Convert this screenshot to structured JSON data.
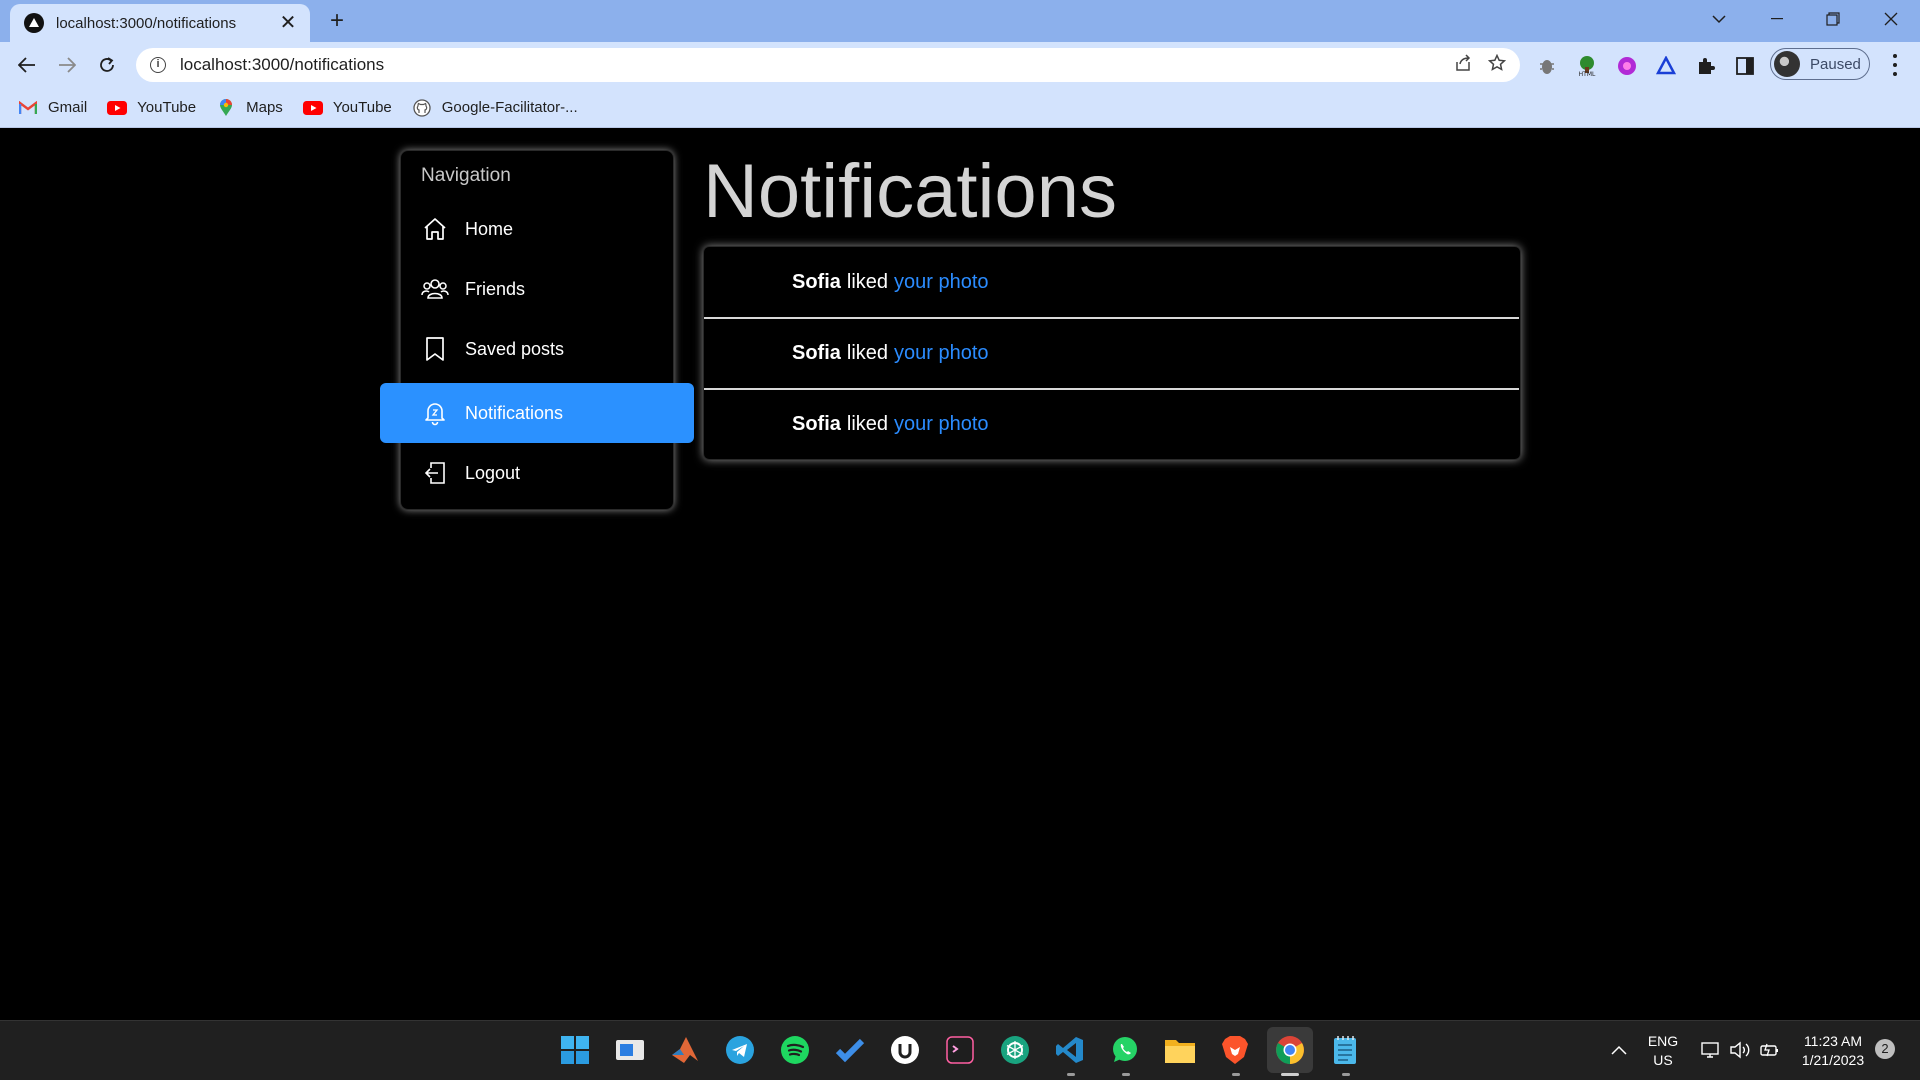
{
  "browser": {
    "tab_title": "localhost:3000/notifications",
    "tab_close": "✕",
    "new_tab": "+",
    "url": "localhost:3000/notifications",
    "profile_label": "Paused",
    "bookmarks": [
      {
        "label": "Gmail",
        "icon": "gmail-icon"
      },
      {
        "label": "YouTube",
        "icon": "youtube-icon"
      },
      {
        "label": "Maps",
        "icon": "maps-icon"
      },
      {
        "label": "YouTube",
        "icon": "youtube-icon"
      },
      {
        "label": "Google-Facilitator-...",
        "icon": "github-icon"
      }
    ]
  },
  "sidebar": {
    "heading": "Navigation",
    "items": [
      {
        "label": "Home",
        "icon": "home-icon"
      },
      {
        "label": "Friends",
        "icon": "friends-icon"
      },
      {
        "label": "Saved posts",
        "icon": "bookmark-icon"
      },
      {
        "label": "Notifications",
        "icon": "bell-icon",
        "active": true
      },
      {
        "label": "Logout",
        "icon": "logout-icon"
      }
    ]
  },
  "main": {
    "title": "Notifications",
    "notifications": [
      {
        "user": "Sofia",
        "action": "liked",
        "link": "your photo"
      },
      {
        "user": "Sofia",
        "action": "liked",
        "link": "your photo"
      },
      {
        "user": "Sofia",
        "action": "liked",
        "link": "your photo"
      }
    ]
  },
  "taskbar": {
    "lang_line1": "ENG",
    "lang_line2": "US",
    "time": "11:23 AM",
    "date": "1/21/2023",
    "notification_count": "2"
  },
  "colors": {
    "accent": "#2b91ff",
    "link": "#2b8cff",
    "page_background": "#000000",
    "chrome_frame": "#8cb0ec",
    "chrome_toolbar": "#d3e3fd"
  }
}
